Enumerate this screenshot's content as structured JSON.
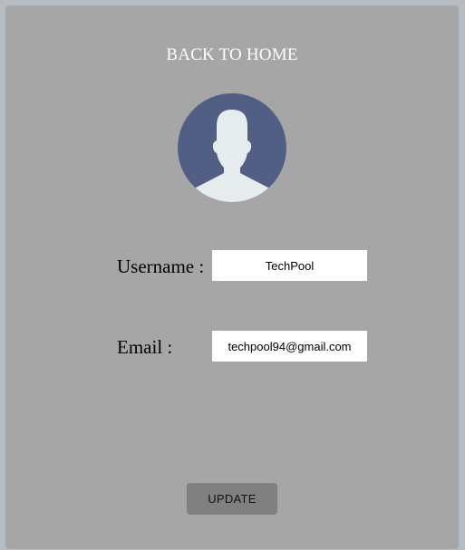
{
  "header": {
    "back_link_label": "BACK TO HOME"
  },
  "avatar": {
    "icon": "user-avatar-icon",
    "circle_color": "#525f84",
    "silhouette_color": "#e6ebee"
  },
  "form": {
    "username_label": "Username :",
    "username_value": "TechPool",
    "email_label": "Email :",
    "email_value": "techpool94@gmail.com"
  },
  "actions": {
    "update_label": "UPDATE"
  },
  "colors": {
    "page_bg": "#b7bcc1",
    "card_bg": "#a6a6a6",
    "button_bg": "#808080"
  }
}
